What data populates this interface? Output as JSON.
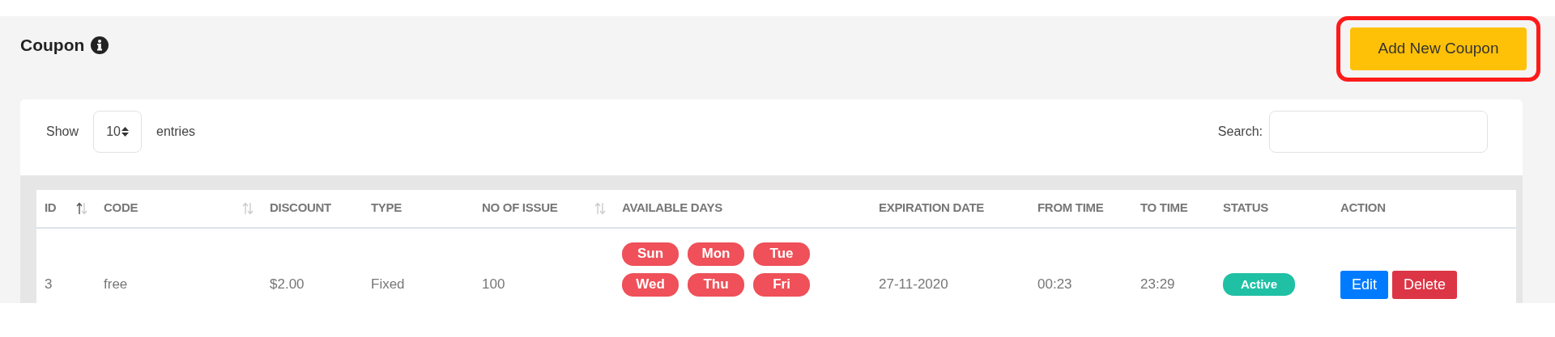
{
  "page": {
    "title": "Coupon"
  },
  "add_button": {
    "label": "Add New Coupon",
    "highlighted": true
  },
  "length_control": {
    "before": "Show",
    "value": "10",
    "after": "entries"
  },
  "search": {
    "label": "Search:"
  },
  "table": {
    "columns": [
      {
        "label": "ID",
        "sortable": true,
        "sorted": true
      },
      {
        "label": "CODE",
        "sortable": true,
        "sorted": false
      },
      {
        "label": "DISCOUNT"
      },
      {
        "label": "TYPE"
      },
      {
        "label": "NO OF ISSUE",
        "sortable": true,
        "sorted": false
      },
      {
        "label": "AVAILABLE DAYS"
      },
      {
        "label": "EXPIRATION DATE"
      },
      {
        "label": "FROM TIME"
      },
      {
        "label": "TO TIME"
      },
      {
        "label": "STATUS"
      },
      {
        "label": "ACTION"
      }
    ],
    "rows": [
      {
        "id": "3",
        "code": "free",
        "discount": "$2.00",
        "type": "Fixed",
        "no_of_issue": "100",
        "available_days": [
          "Sun",
          "Mon",
          "Tue",
          "Wed",
          "Thu",
          "Fri"
        ],
        "expiration_date": "27-11-2020",
        "from_time": "00:23",
        "to_time": "23:29",
        "status": {
          "label": "Active",
          "active": true
        },
        "actions": [
          {
            "label": "Edit",
            "kind": "edit"
          },
          {
            "label": "Delete",
            "kind": "delete"
          }
        ]
      }
    ]
  }
}
